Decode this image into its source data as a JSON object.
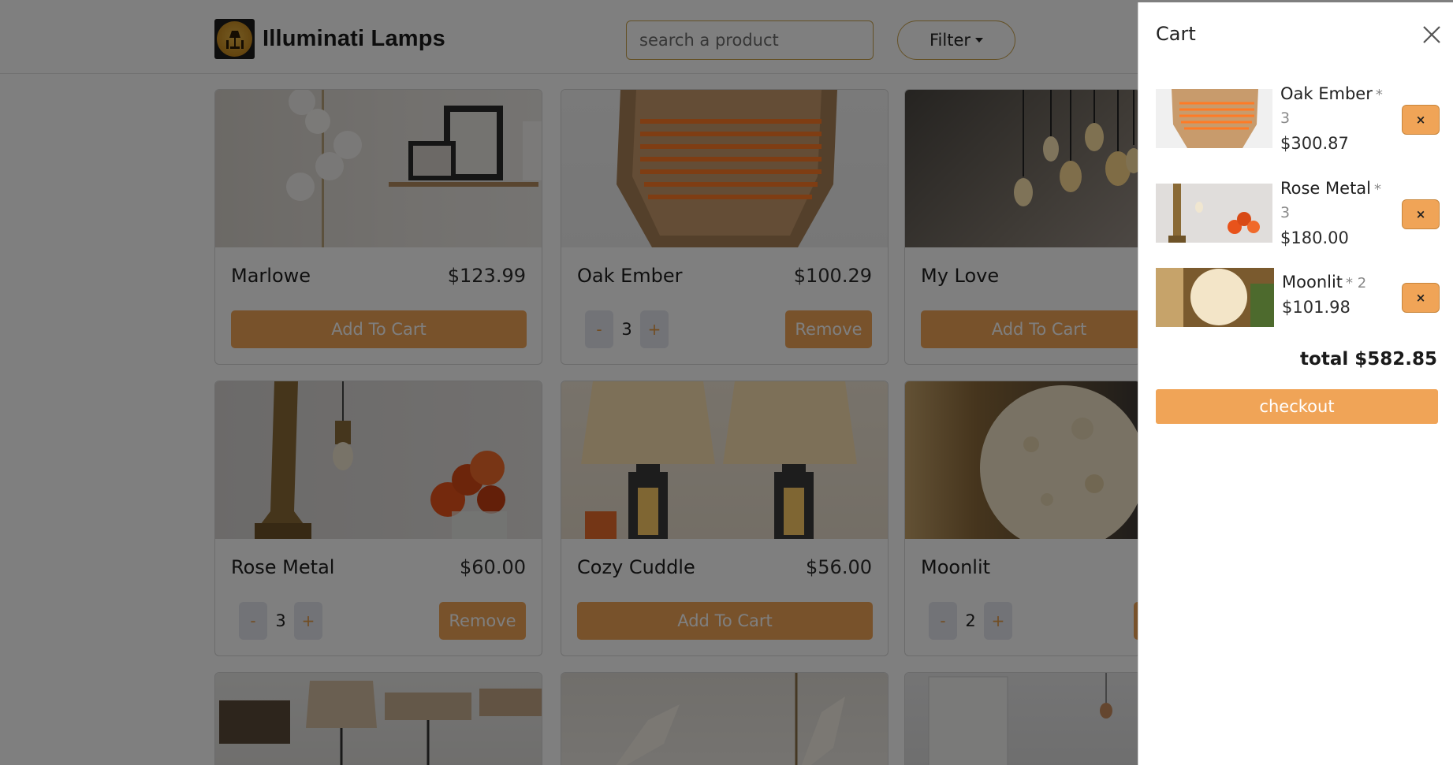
{
  "brand": {
    "name": "Illuminati Lamps",
    "logo_icon": "lamp-logo-icon"
  },
  "search": {
    "placeholder": "search a product"
  },
  "filter": {
    "label": "Filter"
  },
  "products": [
    {
      "name": "Marlowe",
      "price": "$123.99",
      "action": "Add To Cart"
    },
    {
      "name": "Oak Ember",
      "price": "$100.29",
      "qty": "3",
      "minus": "-",
      "plus": "+",
      "action": "Remove"
    },
    {
      "name": "My Love",
      "action": "Add To Cart"
    },
    {
      "name": "Rose Metal",
      "price": "$60.00",
      "qty": "3",
      "minus": "-",
      "plus": "+",
      "action": "Remove"
    },
    {
      "name": "Cozy Cuddle",
      "price": "$56.00",
      "action": "Add To Cart"
    },
    {
      "name": "Moonlit",
      "qty": "2",
      "minus": "-",
      "plus": "+"
    }
  ],
  "cart": {
    "title": "Cart",
    "items": [
      {
        "name": "Oak Ember",
        "mult": "*",
        "qty": "3",
        "price": "$300.87",
        "remove": "×"
      },
      {
        "name": "Rose Metal",
        "mult": "*",
        "qty": "3",
        "price": "$180.00",
        "remove": "×"
      },
      {
        "name": "Moonlit",
        "mult": "* 2",
        "price": "$101.98",
        "remove": "×"
      }
    ],
    "total": "total $582.85",
    "checkout": "checkout"
  },
  "colors": {
    "accent": "#f0a457",
    "border_gold": "#c9a24c",
    "overlay": "rgba(0,0,0,0.5)"
  }
}
